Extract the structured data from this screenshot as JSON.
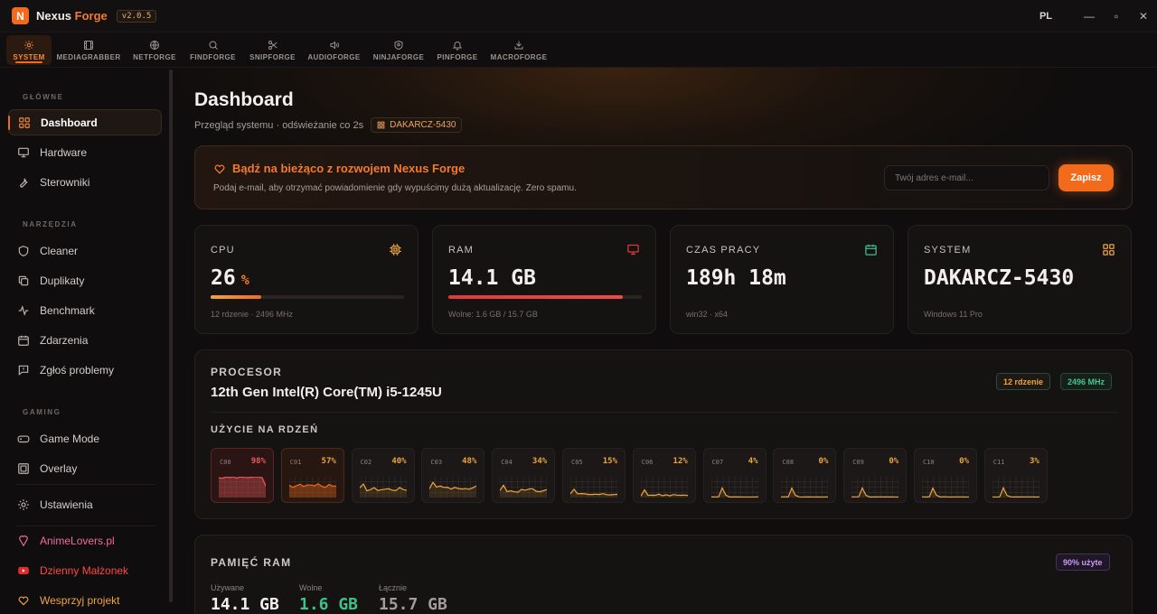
{
  "app": {
    "logo_letter": "N",
    "name_primary": "Nexus",
    "name_accent": "Forge",
    "version": "v2.0.5",
    "language": "PL"
  },
  "window_controls": {
    "minimize": "—",
    "maximize": "▫",
    "close": "✕"
  },
  "tools": [
    {
      "label": "SYSTEM",
      "icon": "gear-icon",
      "active": true
    },
    {
      "label": "MEDIAGRABBER",
      "icon": "film-icon"
    },
    {
      "label": "NETFORGE",
      "icon": "globe-icon"
    },
    {
      "label": "FINDFORGE",
      "icon": "search-icon"
    },
    {
      "label": "SNIPFORGE",
      "icon": "scissors-icon"
    },
    {
      "label": "AUDIOFORGE",
      "icon": "speaker-icon"
    },
    {
      "label": "NINJAFORGE",
      "icon": "shield-icon"
    },
    {
      "label": "PINFORGE",
      "icon": "bell-icon"
    },
    {
      "label": "MACROFORGE",
      "icon": "download-icon"
    }
  ],
  "sidebar": {
    "sections": [
      "GŁÓWNE",
      "NARZĘDZIA",
      "GAMING"
    ],
    "main_items": [
      "Dashboard",
      "Hardware",
      "Sterowniki"
    ],
    "tool_items": [
      "Cleaner",
      "Duplikaty",
      "Benchmark",
      "Zdarzenia",
      "Zgłoś problemy"
    ],
    "gaming_items": [
      "Game Mode",
      "Overlay"
    ],
    "settings": "Ustawienia",
    "links": [
      "AnimeLovers.pl",
      "Dzienny Małżonek",
      "Wesprzyj projekt"
    ]
  },
  "header": {
    "title": "Dashboard",
    "subtitle": "Przegląd systemu · odświeżanie co 2s",
    "hostname": "DAKARCZ-5430"
  },
  "banner": {
    "title": "Bądź na bieżąco z rozwojem Nexus Forge",
    "description": "Podaj e-mail, aby otrzymać powiadomienie gdy wypuścimy dużą aktualizację. Zero spamu.",
    "email_placeholder": "Twój adres e-mail...",
    "email_value": "",
    "button": "Zapisz"
  },
  "stats": {
    "cpu": {
      "label": "CPU",
      "value": "26",
      "unit": "%",
      "percent": 26,
      "footer": "12 rdzenie · 2496 MHz"
    },
    "ram": {
      "label": "RAM",
      "value": "14.1 GB",
      "percent": 90,
      "footer": "Wolne: 1.6 GB / 15.7 GB"
    },
    "uptime": {
      "label": "CZAS PRACY",
      "value": "189h 18m",
      "footer": "win32 · x64"
    },
    "system": {
      "label": "SYSTEM",
      "value": "DAKARCZ-5430",
      "footer": "Windows 11 Pro"
    }
  },
  "processor": {
    "heading": "PROCESOR",
    "name": "12th Gen Intel(R) Core(TM) i5-1245U",
    "cores_badge": "12 rdzenie",
    "freq_badge": "2496 MHz",
    "per_core_heading": "UŻYCIE NA RDZEŃ",
    "cores": [
      {
        "id": "C00",
        "pct": "98%",
        "usage": 98
      },
      {
        "id": "C01",
        "pct": "57%",
        "usage": 57
      },
      {
        "id": "C02",
        "pct": "40%",
        "usage": 40
      },
      {
        "id": "C03",
        "pct": "48%",
        "usage": 48
      },
      {
        "id": "C04",
        "pct": "34%",
        "usage": 34
      },
      {
        "id": "C05",
        "pct": "15%",
        "usage": 15
      },
      {
        "id": "C06",
        "pct": "12%",
        "usage": 12
      },
      {
        "id": "C07",
        "pct": "4%",
        "usage": 4
      },
      {
        "id": "C08",
        "pct": "0%",
        "usage": 0
      },
      {
        "id": "C09",
        "pct": "0%",
        "usage": 0
      },
      {
        "id": "C10",
        "pct": "0%",
        "usage": 0
      },
      {
        "id": "C11",
        "pct": "3%",
        "usage": 3
      }
    ]
  },
  "ram_section": {
    "heading": "PAMIĘĆ RAM",
    "badge": "90% użyte",
    "used_label": "Używane",
    "used_value": "14.1 GB",
    "free_label": "Wolne",
    "free_value": "1.6 GB",
    "total_label": "Łącznie",
    "total_value": "15.7 GB"
  },
  "colors": {
    "accent": "#f26a1b",
    "danger": "#e0393e",
    "success": "#3fbf8a",
    "amber": "#f0a53b"
  }
}
